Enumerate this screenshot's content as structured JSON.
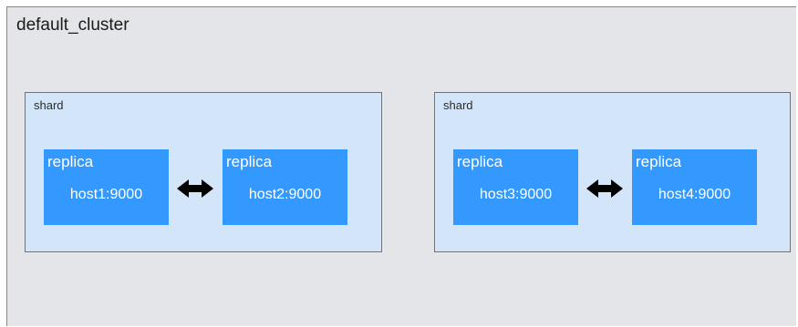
{
  "cluster": {
    "title": "default_cluster"
  },
  "shards": [
    {
      "label": "shard",
      "replicas": [
        {
          "title": "replica",
          "host": "host1:9000"
        },
        {
          "title": "replica",
          "host": "host2:9000"
        }
      ]
    },
    {
      "label": "shard",
      "replicas": [
        {
          "title": "replica",
          "host": "host3:9000"
        },
        {
          "title": "replica",
          "host": "host4:9000"
        }
      ]
    }
  ],
  "colors": {
    "cluster_bg": "#e3e5e8",
    "shard_bg": "#d3e5f9",
    "replica_bg": "#3399ff",
    "arrow": "#000000"
  },
  "icons": {
    "replication": "double-arrow-icon"
  }
}
